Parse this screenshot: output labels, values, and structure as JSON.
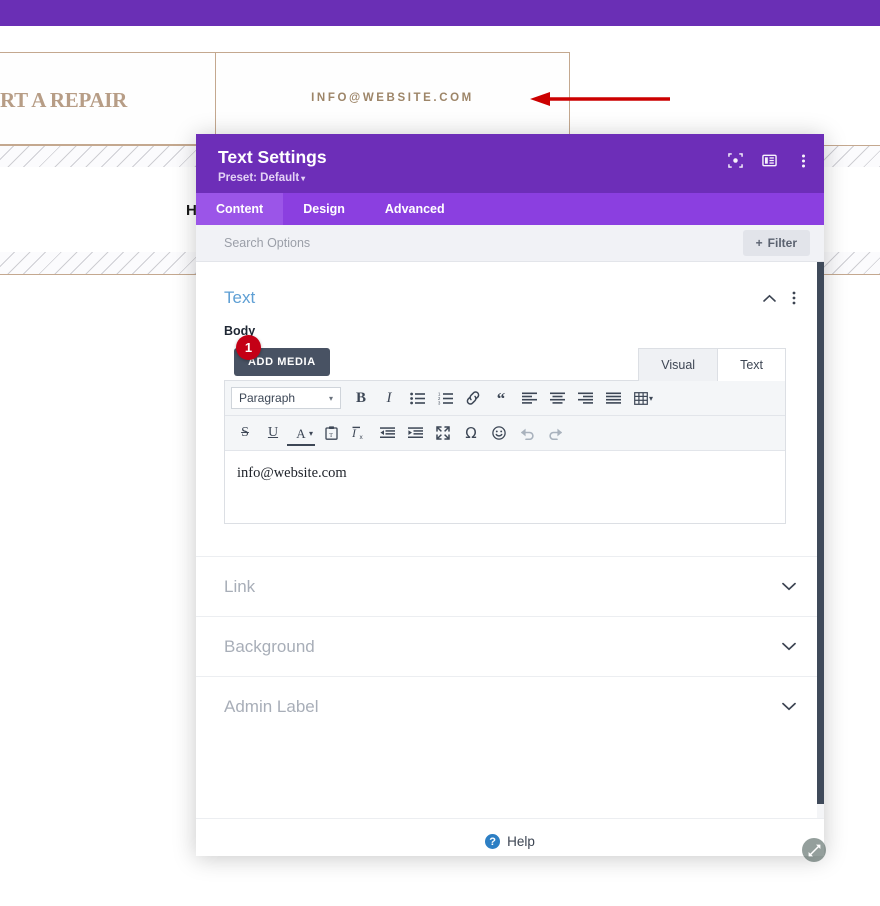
{
  "website": {
    "nav_repair_label": "RT A REPAIR",
    "nav_email_label": "INFO@WEBSITE.COM",
    "heading_fragment": "H",
    "annotation_arrow": "red-left-arrow"
  },
  "modal": {
    "title": "Text Settings",
    "preset_label": "Preset: Default",
    "preset_caret": "▾",
    "header_icons": [
      {
        "name": "focus-target-icon"
      },
      {
        "name": "panel-layout-icon"
      },
      {
        "name": "more-vertical-icon"
      }
    ],
    "tabs": [
      {
        "label": "Content",
        "active": true
      },
      {
        "label": "Design",
        "active": false
      },
      {
        "label": "Advanced",
        "active": false
      }
    ],
    "search": {
      "placeholder": "Search Options",
      "filter_label": "Filter",
      "filter_plus": "+"
    },
    "section": {
      "title": "Text",
      "collapse_icon": "chevron-up-icon",
      "menu_icon": "more-vertical-icon",
      "field_label": "Body"
    },
    "editor": {
      "add_media_label": "ADD MEDIA",
      "mode_tabs": [
        {
          "label": "Visual",
          "active": true
        },
        {
          "label": "Text",
          "active": false
        }
      ],
      "format_select_value": "Paragraph",
      "format_select_caret": "▾",
      "toolbar_row1": [
        {
          "name": "bold-icon",
          "glyph": "B"
        },
        {
          "name": "italic-icon",
          "glyph": "I"
        },
        {
          "name": "bullet-list-icon",
          "glyph": ""
        },
        {
          "name": "numbered-list-icon",
          "glyph": ""
        },
        {
          "name": "link-icon",
          "glyph": ""
        },
        {
          "name": "blockquote-icon",
          "glyph": "❝"
        },
        {
          "name": "align-left-icon",
          "glyph": ""
        },
        {
          "name": "align-center-icon",
          "glyph": ""
        },
        {
          "name": "align-right-icon",
          "glyph": ""
        },
        {
          "name": "align-justify-icon",
          "glyph": ""
        },
        {
          "name": "table-icon",
          "glyph": ""
        }
      ],
      "toolbar_row2": [
        {
          "name": "strikethrough-icon",
          "glyph": "S"
        },
        {
          "name": "underline-icon",
          "glyph": "U"
        },
        {
          "name": "text-color-icon",
          "glyph": "A"
        },
        {
          "name": "paste-as-text-icon",
          "glyph": ""
        },
        {
          "name": "clear-formatting-icon",
          "glyph": ""
        },
        {
          "name": "outdent-icon",
          "glyph": ""
        },
        {
          "name": "indent-icon",
          "glyph": ""
        },
        {
          "name": "fullscreen-icon",
          "glyph": ""
        },
        {
          "name": "special-character-icon",
          "glyph": "Ω"
        },
        {
          "name": "emoji-icon",
          "glyph": "☺"
        },
        {
          "name": "undo-icon",
          "glyph": "↰"
        },
        {
          "name": "redo-icon",
          "glyph": "↱"
        }
      ],
      "content_value": "info@website.com",
      "step_badge": "1"
    },
    "accordions": [
      {
        "label": "Link",
        "chevron": "⌄"
      },
      {
        "label": "Background",
        "chevron": "⌄"
      },
      {
        "label": "Admin Label",
        "chevron": "⌄"
      }
    ],
    "help": {
      "icon_glyph": "?",
      "label": "Help"
    },
    "footer_buttons": [
      {
        "name": "cancel-button",
        "icon": "close-icon",
        "glyph": "✖",
        "color": "#ec5b57"
      },
      {
        "name": "undo-button",
        "icon": "undo-icon",
        "glyph": "↺",
        "color": "#8233d6"
      },
      {
        "name": "redo-button",
        "icon": "redo-icon",
        "glyph": "↻",
        "color": "#1f8ed6"
      },
      {
        "name": "save-button",
        "icon": "check-icon",
        "glyph": "✔",
        "color": "#2bbf99"
      }
    ],
    "resize_handle_icon": "resize-diagonal-icon"
  },
  "colors": {
    "header_purple": "#6d2eb8",
    "tabs_purple": "#8b3fe0",
    "tab_active_purple": "#9b55e8",
    "top_bar_purple": "#6a2fb5",
    "section_title_blue": "#5e9fd4",
    "badge_red": "#c40016",
    "annotation_red": "#cc0000"
  }
}
